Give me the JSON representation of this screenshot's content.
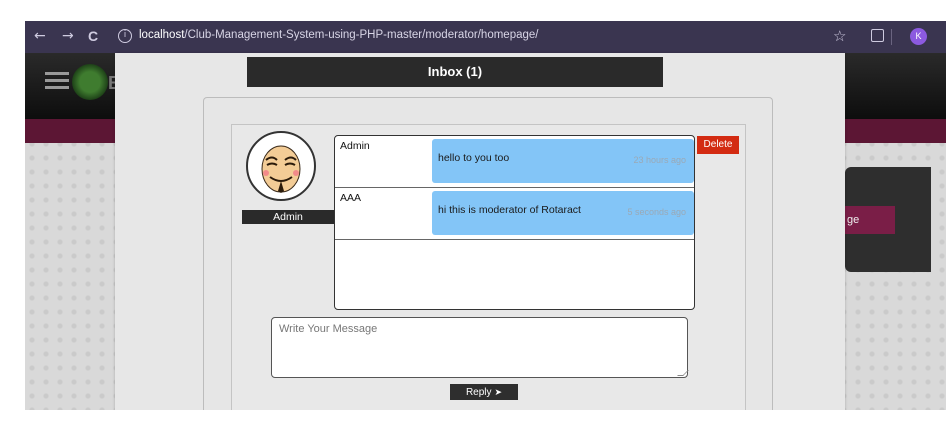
{
  "browser": {
    "back": "←",
    "forward": "→",
    "reload": "C",
    "info": "i",
    "url_host": "localhost",
    "url_path": "/Club-Management-System-using-PHP-master/moderator/homepage/",
    "star": "☆",
    "profile_initial": "K"
  },
  "background": {
    "logo_letter": "B",
    "right_button": "ge"
  },
  "modal": {
    "title": "Inbox (1)",
    "recipient": "Admin",
    "delete_label": "Delete",
    "messages": [
      {
        "sender": "Admin",
        "text": "hello to you too",
        "time": "23 hours ago"
      },
      {
        "sender": "AAA",
        "text": "hi this is moderator of Rotaract",
        "time": "5 seconds ago"
      }
    ],
    "input_placeholder": "Write Your Message",
    "reply_label": "Reply"
  },
  "colors": {
    "browser_bar": "#3a3550",
    "header_dark": "#2a2a2a",
    "bubble": "#83c5f7",
    "delete": "#d32b12",
    "strip": "#5c1634",
    "profile": "#8c5ae0"
  }
}
